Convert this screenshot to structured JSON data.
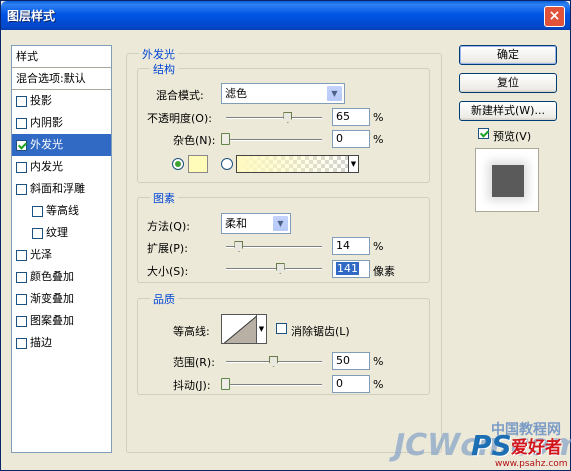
{
  "window": {
    "title": "图层样式",
    "close": "×"
  },
  "stylelist": {
    "header": "样式",
    "blend": "混合选项:默认",
    "items": [
      {
        "label": "投影",
        "checked": false,
        "sub": false,
        "selected": false
      },
      {
        "label": "内阴影",
        "checked": false,
        "sub": false,
        "selected": false
      },
      {
        "label": "外发光",
        "checked": true,
        "sub": false,
        "selected": true
      },
      {
        "label": "内发光",
        "checked": false,
        "sub": false,
        "selected": false
      },
      {
        "label": "斜面和浮雕",
        "checked": false,
        "sub": false,
        "selected": false
      },
      {
        "label": "等高线",
        "checked": false,
        "sub": true,
        "selected": false
      },
      {
        "label": "纹理",
        "checked": false,
        "sub": true,
        "selected": false
      },
      {
        "label": "光泽",
        "checked": false,
        "sub": false,
        "selected": false
      },
      {
        "label": "颜色叠加",
        "checked": false,
        "sub": false,
        "selected": false
      },
      {
        "label": "渐变叠加",
        "checked": false,
        "sub": false,
        "selected": false
      },
      {
        "label": "图案叠加",
        "checked": false,
        "sub": false,
        "selected": false
      },
      {
        "label": "描边",
        "checked": false,
        "sub": false,
        "selected": false
      }
    ]
  },
  "outer_glow": {
    "title": "外发光",
    "structure": {
      "title": "结构",
      "blend_mode_label": "混合模式:",
      "blend_mode_value": "滤色",
      "opacity_label": "不透明度(O):",
      "opacity_value": "65",
      "opacity_fraction": 0.65,
      "noise_label": "杂色(N):",
      "noise_value": "0",
      "noise_fraction": 0,
      "unit": "%",
      "swatch_color": "#fffbb9"
    },
    "elements": {
      "title": "图素",
      "technique_label": "方法(Q):",
      "technique_value": "柔和",
      "spread_label": "扩展(P):",
      "spread_value": "14",
      "spread_fraction": 0.14,
      "size_label": "大小(S):",
      "size_value": "141",
      "size_fraction": 0.57,
      "size_unit": "像素",
      "unit": "%"
    },
    "quality": {
      "title": "品质",
      "contour_label": "等高线:",
      "antialias_label": "消除锯齿(L)",
      "antialias_checked": false,
      "range_label": "范围(R):",
      "range_value": "50",
      "range_fraction": 0.5,
      "jitter_label": "抖动(J):",
      "jitter_value": "0",
      "jitter_fraction": 0,
      "unit": "%"
    }
  },
  "buttons": {
    "ok": "确定",
    "reset": "复位",
    "new_style": "新建样式(W)...",
    "preview_label": "预览(V)",
    "preview_checked": true
  },
  "watermark": {
    "ps": "PS",
    "love": "爱好者",
    "site": "JCWcn.com",
    "cn": "中国教程网",
    "url": "www.psahz.com"
  }
}
